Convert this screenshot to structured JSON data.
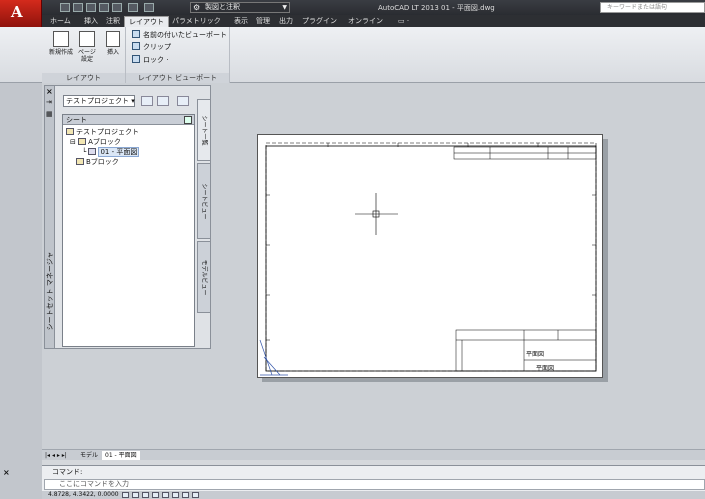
{
  "title_bar": {
    "workspace": "製図と注釈",
    "title": "AutoCAD LT 2013   01 - 平面図.dwg",
    "search_placeholder": "キーワードまたは語句"
  },
  "tabs": [
    {
      "label": "ホーム"
    },
    {
      "label": "挿入"
    },
    {
      "label": "注釈"
    },
    {
      "label": "レイアウト"
    },
    {
      "label": "パラメトリック"
    },
    {
      "label": "表示"
    },
    {
      "label": "管理"
    },
    {
      "label": "出力"
    },
    {
      "label": "プラグイン"
    },
    {
      "label": "オンライン"
    }
  ],
  "ribbon": {
    "new_layout": "新規作成",
    "page_setup_a": "ページ",
    "page_setup_b": "設定",
    "insert_view": "挿入",
    "panel_layout": "レイアウト",
    "named_viewport": "名前の付いたビューポート",
    "clip": "クリップ",
    "lock": "ロック ·",
    "panel_viewport": "レイアウト ビューポート"
  },
  "ssm": {
    "project": "テストプロジェクト",
    "tree_header": "シート",
    "tree": {
      "root": "テストプロジェクト",
      "block_a": "Aブロック",
      "sheet": "01 - 平面図",
      "block_b": "Bブロック"
    },
    "tab_sheets": "シート一覧",
    "tab_views": "シートビュー",
    "tab_model": "モデルビュー",
    "title": "シートセット マネージャ"
  },
  "drawing": {
    "title_block_sheet": "平面図",
    "title_block_sheet2": "平面図"
  },
  "layout_tabs": {
    "model": "モデル",
    "layout": "01 - 平面図"
  },
  "command": {
    "history": "コマンド:",
    "placeholder": "ここにコマンドを入力"
  },
  "status": {
    "coords": "4.8728, 4.3422, 0.0000"
  }
}
